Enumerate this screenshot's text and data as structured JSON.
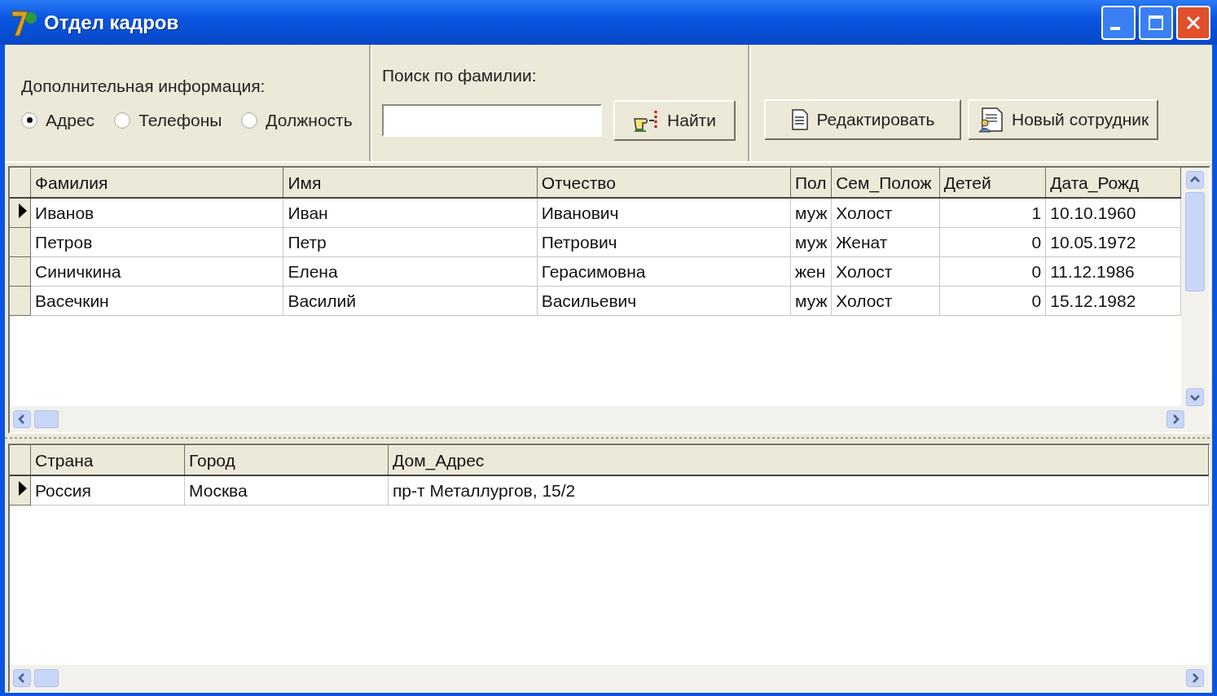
{
  "window": {
    "title": "Отдел кадров"
  },
  "extra_info": {
    "label": "Дополнительная информация:",
    "options": [
      {
        "label": "Адрес",
        "selected": true
      },
      {
        "label": "Телефоны",
        "selected": false
      },
      {
        "label": "Должность",
        "selected": false
      }
    ]
  },
  "search": {
    "label": "Поиск по фамилии:",
    "button": "Найти"
  },
  "buttons": [
    {
      "label": "Редактировать",
      "kind": "edit"
    },
    {
      "label": "Новый сотрудник",
      "kind": "new"
    }
  ],
  "employees": {
    "columns": [
      {
        "label": "Фамилия",
        "kind": "text"
      },
      {
        "label": "Имя",
        "kind": "text"
      },
      {
        "label": "Отчество",
        "kind": "text"
      },
      {
        "label": "Пол",
        "kind": "text"
      },
      {
        "label": "Сем_Полож",
        "kind": "text"
      },
      {
        "label": "Детей",
        "kind": "number"
      },
      {
        "label": "Дата_Рожд",
        "kind": "text"
      }
    ],
    "rows": [
      {
        "selected": true,
        "cells": [
          "Иванов",
          "Иван",
          "Иванович",
          "муж",
          "Холост",
          "1",
          "10.10.1960"
        ]
      },
      {
        "selected": false,
        "cells": [
          "Петров",
          "Петр",
          "Петрович",
          "муж",
          "Женат",
          "0",
          "10.05.1972"
        ]
      },
      {
        "selected": false,
        "cells": [
          "Синичкина",
          "Елена",
          "Герасимовна",
          "жен",
          "Холост",
          "0",
          "11.12.1986"
        ]
      },
      {
        "selected": false,
        "cells": [
          "Васечкин",
          "Василий",
          "Васильевич",
          "муж",
          "Холост",
          "0",
          "15.12.1982"
        ]
      }
    ]
  },
  "details": {
    "columns": [
      {
        "label": "Страна",
        "kind": "text"
      },
      {
        "label": "Город",
        "kind": "text"
      },
      {
        "label": "Дом_Адрес",
        "kind": "text"
      }
    ],
    "rows": [
      {
        "selected": true,
        "cells": [
          "Россия",
          "Москва",
          "пр-т Металлургов, 15/2"
        ]
      }
    ]
  }
}
